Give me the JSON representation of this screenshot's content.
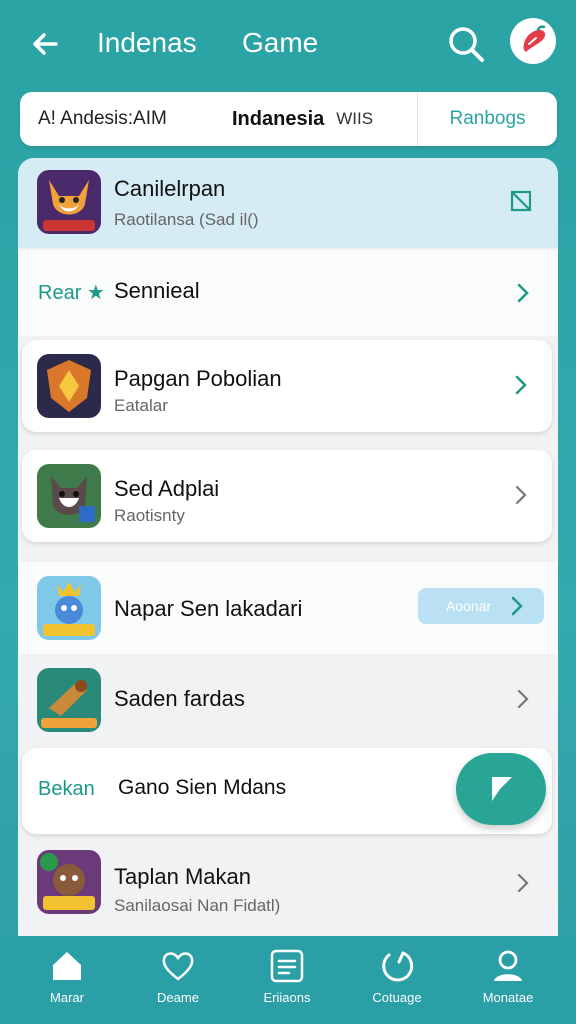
{
  "header": {
    "title_left": "Indenas",
    "title_right": "Game"
  },
  "tabs": {
    "tab1": "A! Andesis:AIM",
    "tab2_main": "Indanesia",
    "tab2_small": "WIIS",
    "tab3": "Ranbogs"
  },
  "list": {
    "featured": {
      "title": "Canilelrpan",
      "subtitle": "Raotilansa (Sad il()"
    },
    "section_label": "Rear ★",
    "section_title": "Sennieal",
    "items": [
      {
        "title": "Papgan  Pobolian",
        "subtitle": "Eatalar"
      },
      {
        "title": "Sed Adplai",
        "subtitle": "Raotisnty"
      },
      {
        "title": "Napar Sen lakadari",
        "button": "Aoonar"
      },
      {
        "title": "Saden fardas"
      },
      {
        "label": "Bekan",
        "title": "Gano Sien Mdans"
      },
      {
        "title": "Taplan Makan",
        "subtitle": "Sanilaosai Nan Fidatl)"
      }
    ]
  },
  "bottom_nav": [
    {
      "label": "Marar",
      "icon": "home-icon"
    },
    {
      "label": "Deame",
      "icon": "heart-icon"
    },
    {
      "label": "Eriiaons",
      "icon": "list-icon"
    },
    {
      "label": "Cotuage",
      "icon": "refresh-icon"
    },
    {
      "label": "Monatae",
      "icon": "user-icon"
    }
  ],
  "colors": {
    "accent": "#2aa3a4",
    "teal_dark": "#1c9a86",
    "highlight": "#d6ecf5"
  }
}
